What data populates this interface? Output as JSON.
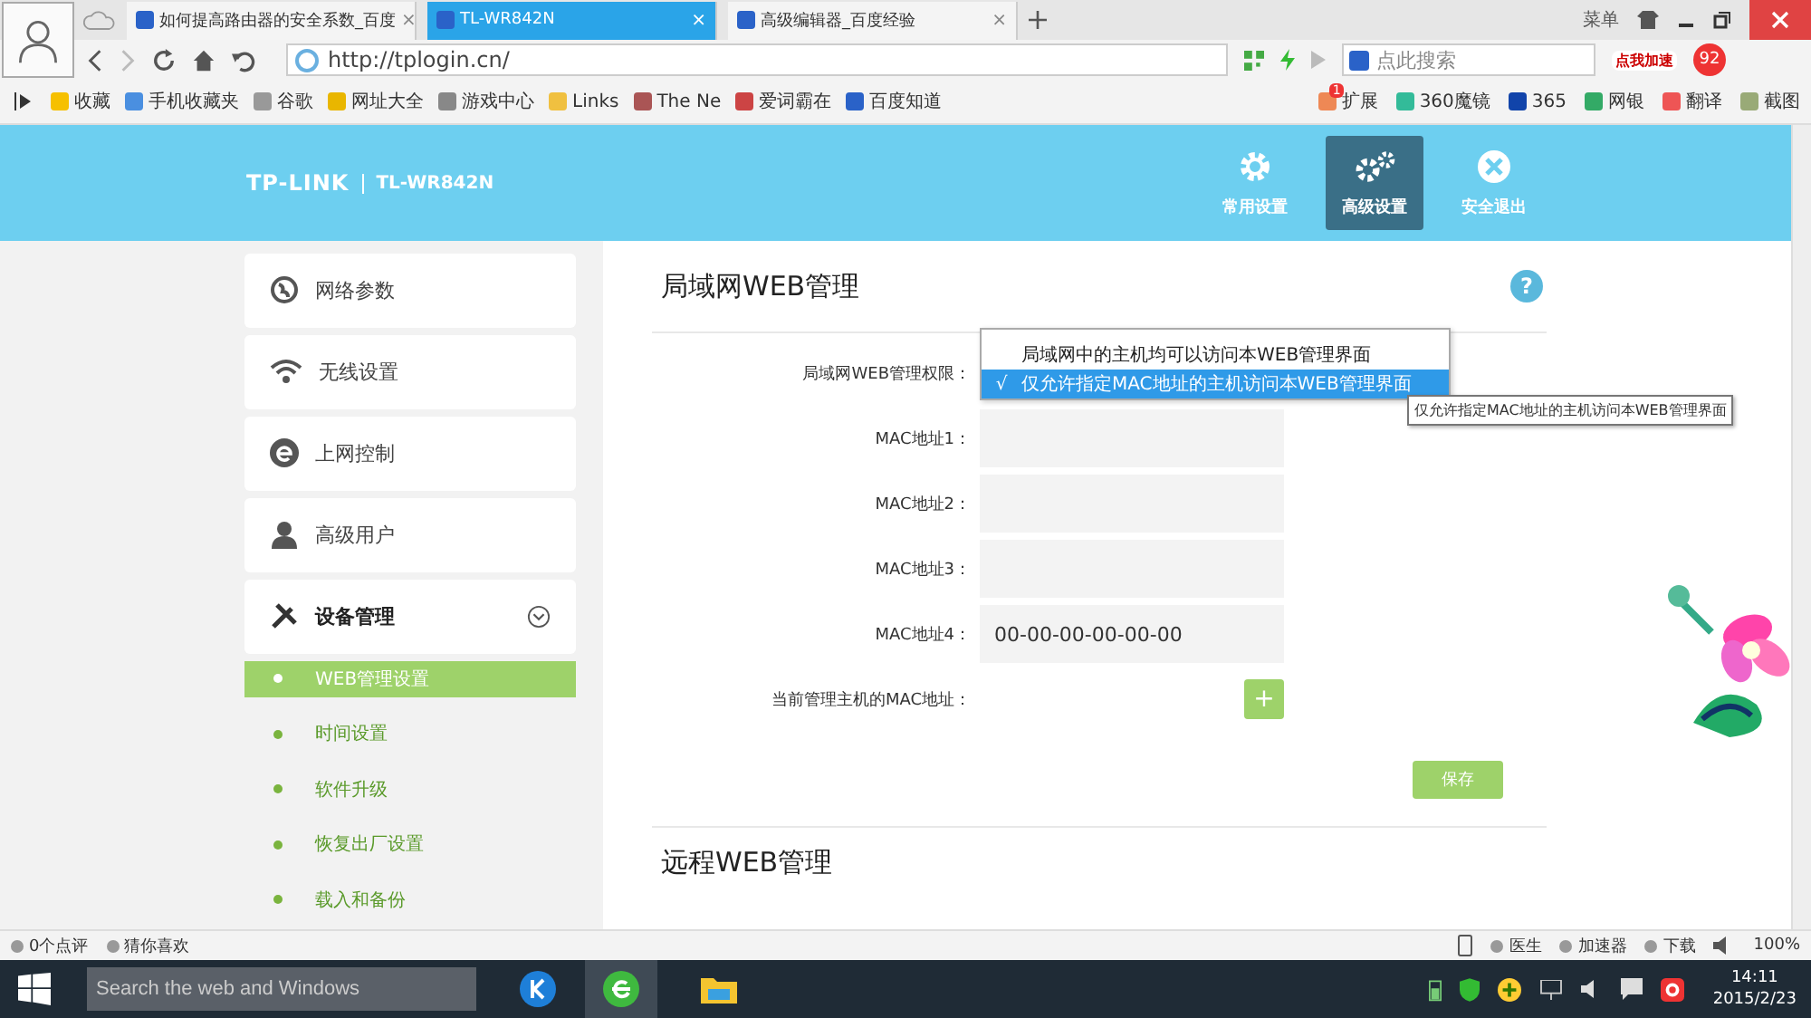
{
  "browser": {
    "tabs": [
      {
        "title": "如何提高路由器的安全系数_百度",
        "selected": false
      },
      {
        "title": "TL-WR842N",
        "selected": true
      },
      {
        "title": "高级编辑器_百度经验",
        "selected": false
      }
    ],
    "tab_close": "×",
    "menu_label": "菜单",
    "address": "http://tplogin.cn/",
    "search_placeholder": "点此搜索",
    "promo": "点我加速",
    "promo_badge": "92",
    "bookmarks": [
      "收藏",
      "手机收藏夹",
      "谷歌",
      "网址大全",
      "游戏中心",
      "Links",
      "The Ne",
      "爱词霸在",
      "百度知道"
    ],
    "tools": [
      {
        "label": "扩展",
        "badge": "1"
      },
      {
        "label": "360魔镜"
      },
      {
        "label": "365"
      },
      {
        "label": "网银"
      },
      {
        "label": "翻译"
      },
      {
        "label": "截图"
      }
    ]
  },
  "router": {
    "brand": "TP-LINK",
    "model": "TL-WR842N",
    "nav": [
      {
        "label": "常用设置",
        "selected": false
      },
      {
        "label": "高级设置",
        "selected": true
      },
      {
        "label": "安全退出",
        "selected": false
      }
    ],
    "sidebar": [
      {
        "label": "网络参数",
        "expanded": false
      },
      {
        "label": "无线设置",
        "expanded": false
      },
      {
        "label": "上网控制",
        "expanded": false
      },
      {
        "label": "高级用户",
        "expanded": false
      },
      {
        "label": "设备管理",
        "expanded": true,
        "children": [
          {
            "label": "WEB管理设置",
            "selected": true
          },
          {
            "label": "时间设置",
            "selected": false
          },
          {
            "label": "软件升级",
            "selected": false
          },
          {
            "label": "恢复出厂设置",
            "selected": false
          },
          {
            "label": "载入和备份",
            "selected": false
          }
        ]
      }
    ],
    "section_title": "局域网WEB管理",
    "help": "?",
    "permission_label": "局域网WEB管理权限：",
    "permission_options": [
      {
        "label": "局域网中的主机均可以访问本WEB管理界面",
        "selected": false
      },
      {
        "label": "仅允许指定MAC地址的主机访问本WEB管理界面",
        "selected": true
      }
    ],
    "check_mark": "√",
    "tooltip": "仅允许指定MAC地址的主机访问本WEB管理界面",
    "mac_fields": [
      {
        "label": "MAC地址1："
      },
      {
        "label": "MAC地址2："
      },
      {
        "label": "MAC地址3："
      },
      {
        "label": "MAC地址4：",
        "value": "00-00-00-00-00-00"
      }
    ],
    "current_mac_label": "当前管理主机的MAC地址：",
    "add_button": "+",
    "save_button": "保存",
    "section2_title": "远程WEB管理"
  },
  "status_bar": {
    "left": [
      "0个点评",
      "猜你喜欢"
    ],
    "right": [
      "医生",
      "加速器",
      "下载"
    ],
    "zoom": "100%"
  },
  "taskbar": {
    "search_placeholder": "Search the web and Windows",
    "time": "14:11",
    "date": "2015/2/23"
  }
}
